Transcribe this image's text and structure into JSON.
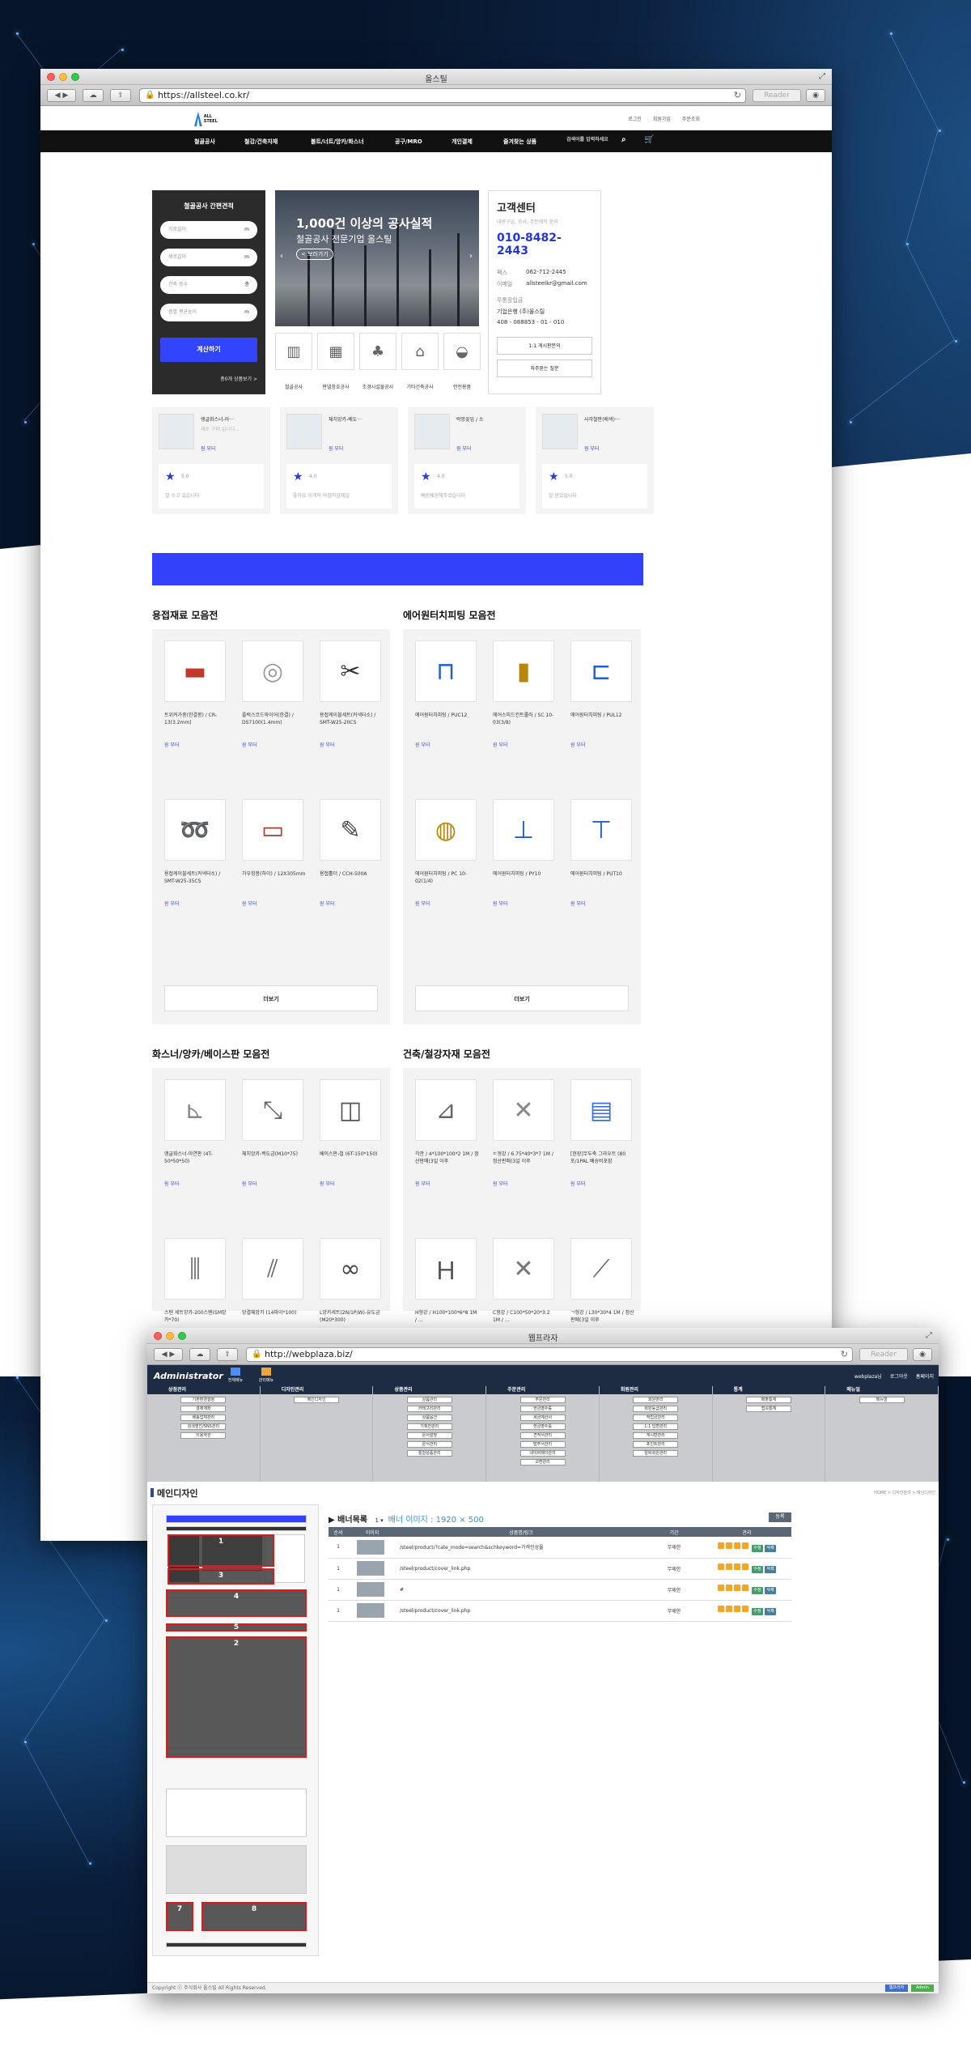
{
  "colors": {
    "accent": "#3441fb",
    "phone": "#2336d6",
    "dark": "#111111",
    "admin_nav": "#1d2b43",
    "highlight": "#e01818"
  },
  "window1": {
    "title": "올스틸",
    "url": "https://allsteel.co.kr/",
    "reader": "Reader",
    "logo": "ALL STEEL",
    "top_links": [
      "로그인",
      "회원가입",
      "주문조회"
    ],
    "nav": [
      "철골공사",
      "철강/건축자재",
      "볼트/너트/앙카/화스너",
      "공구/MRO",
      "개인결제",
      "즐겨찾는 상품"
    ],
    "search_placeholder": "검색어를 입력하세요",
    "calc": {
      "title": "철골공사 간편견적",
      "fields": [
        {
          "ph": "가로길이",
          "unit": "m"
        },
        {
          "ph": "세로길이",
          "unit": "m"
        },
        {
          "ph": "건축 층수",
          "unit": "층"
        },
        {
          "ph": "층별 평균높이",
          "unit": "m"
        }
      ],
      "button": "계산하기",
      "total": "총0개 상품보기 >"
    },
    "banner": {
      "line1": "1,000건 이상의 공사실적",
      "line2": "철골공사 전문기업 올스틸",
      "more": "< 보러가기"
    },
    "categories": [
      "철골공사",
      "판넬창호공사",
      "조경시설물공사",
      "기타건축공사",
      "안전용품"
    ],
    "cs": {
      "title": "고객센터",
      "sub": "대량구입, 공사, 주문제작 문의",
      "phone": "010-8482-2443",
      "fax_label": "팩스",
      "fax": "062-712-2445",
      "mail_label": "이메일",
      "mail": "allsteelkr@gmail.com",
      "bank_label": "무통장입금",
      "bank": "기업은행 (주)올스틸",
      "account": "408 - 088853 - 01 - 010",
      "btn1": "1:1 게시판문의",
      "btn2": "자주묻는 질문"
    },
    "reviews": [
      {
        "name": "앵글화스너-아···",
        "sub": "새로 구매 입니다...",
        "price": "원 부터",
        "score": "5.0",
        "text": "잘 쓰고 있습니다"
      },
      {
        "name": "체치앙카-배도···",
        "sub": "",
        "price": "원 부터",
        "score": "4.0",
        "text": "좋아요 이게딱 마감마감제일"
      },
      {
        "name": "락앙꽂입 / 소",
        "sub": "",
        "price": "원 부터",
        "score": "4.0",
        "text": "빠른배송해주셨습니다"
      },
      {
        "name": "사각철판(배색)···",
        "sub": "",
        "price": "원 부터",
        "score": "5.0",
        "text": "잘 받았습니다"
      }
    ],
    "sections": [
      {
        "title": "용접재료 모음전",
        "more": "더보기",
        "items": [
          {
            "name": "트위커가중(한결봉) / CR-13(3.2mm)",
            "price": "원 부터"
          },
          {
            "name": "플럭스코드와이어(한결) / DS7100(1.4mm)",
            "price": "원 부터"
          },
          {
            "name": "용접케이블세트(커넥터소) / SMT-W25-20CS",
            "price": "원 부터"
          },
          {
            "name": "용접케이블세트(커넥터소) / SMT-W25-35CS",
            "price": "원 부터"
          },
          {
            "name": "가우징봉(하이) / 12X305mm",
            "price": "원 부터"
          },
          {
            "name": "용접홀더 / CCH-500A",
            "price": "원 부터"
          }
        ]
      },
      {
        "title": "에어원터치피팅 모음전",
        "more": "더보기",
        "items": [
          {
            "name": "에어원터치피팅 / PUC12",
            "price": "원 부터"
          },
          {
            "name": "에어스피드컨트롤러 / SC 10-03(3/8)",
            "price": "원 부터"
          },
          {
            "name": "에어원터치피팅 / PUL12",
            "price": "원 부터"
          },
          {
            "name": "에어원터치피팅 / PC 10-02(1/4)",
            "price": "원 부터"
          },
          {
            "name": "에어원터치피팅 / PY10",
            "price": "원 부터"
          },
          {
            "name": "에어원터치피팅 / PUT10",
            "price": "원 부터"
          }
        ]
      },
      {
        "title": "화스너/앙카/베이스판 모음전",
        "more": "더보기",
        "items": [
          {
            "name": "앵글화스너-아연판 (4T-50*50*50)",
            "price": "원 부터"
          },
          {
            "name": "체치앙카-백도금(M10*75)",
            "price": "원 부터"
          },
          {
            "name": "베이스판-철 (6T-150*150)",
            "price": "원 부터"
          },
          {
            "name": "스텐 세트앙카-200스텐(SM앙카*70)",
            "price": "원 부터"
          },
          {
            "name": "앙결체앙카 (14파이*100)",
            "price": "원 부터"
          },
          {
            "name": "L앙카세트(2N/1P/W)-유도금 (M20*300)",
            "price": "원 부터"
          }
        ]
      },
      {
        "title": "건축/철강자재 모음전",
        "more": "더보기",
        "items": [
          {
            "name": "각관 / 4*100*100*2 1M / 정산판매(3일 이후",
            "price": "원 부터"
          },
          {
            "name": "ㄷ형강 / 6.75*40*3*7 1M / 정산판매(3일 이후",
            "price": "원 부터"
          },
          {
            "name": "[현장]무두축 그라우트 (80포/1PAL 배송비포함",
            "price": "원 부터"
          },
          {
            "name": "H형강 / H100*100*6*8 1M / ...",
            "price": "원 부터"
          },
          {
            "name": "C형강 / C100*50*20*3.2 1M / ...",
            "price": "원 부터"
          },
          {
            "name": "ㄱ형강 / L30*30*4 1M / 정산판매(3일 이후",
            "price": "원 부터"
          }
        ]
      }
    ]
  },
  "window2": {
    "title": "웹프라자",
    "url": "http://webplaza.biz/",
    "reader": "Reader",
    "app": "Administrator",
    "icons": [
      "전체메뉴",
      "관리메뉴"
    ],
    "user": "webplaza님",
    "header_links": [
      "로그아웃",
      "홈페이지"
    ],
    "menu": [
      {
        "head": "상점관리",
        "items": [
          "기본환경설정",
          "결제계좌",
          "배송업체관리",
          "검색엔진/SNS관리",
          "이용약관"
        ]
      },
      {
        "head": "디자인관리",
        "items": [
          "메인디자인"
        ]
      },
      {
        "head": "상품관리",
        "items": [
          "상품관리",
          "카테고리관리",
          "상품옵션",
          "기획전관리",
          "문서설정",
          "문서관리",
          "통합상품관리"
        ]
      },
      {
        "head": "주문관리",
        "items": [
          "주문관리",
          "현금영수증",
          "세금계산서",
          "현금영수증",
          "견적서관리",
          "발주서관리",
          "네이버페이관리",
          "교환관리"
        ]
      },
      {
        "head": "회원관리",
        "items": [
          "회원관리",
          "회원등급관리",
          "적립금관리",
          "1:1 답변관리",
          "게시판관리",
          "포인트관리",
          "탈퇴회원관리"
        ]
      },
      {
        "head": "통계",
        "items": [
          "매출통계",
          "접속통계"
        ]
      },
      {
        "head": "메뉴얼",
        "items": [
          "메뉴얼"
        ]
      }
    ],
    "page_title": "메인디자인",
    "breadcrumb": "HOME > 디자인관리 > 메인디자인",
    "list_title": "배너목록",
    "list_select": "1 ▾",
    "size_label": "배너 이미지 : 1920 × 500",
    "register": "등록",
    "columns": [
      "순서",
      "이미지",
      "상품명/링크",
      "기간",
      "관리"
    ],
    "rows": [
      {
        "no": "1",
        "link": "/steel/product/?cate_mode=search&schkeyword=가격인상율",
        "period": "무제한"
      },
      {
        "no": "1",
        "link": "/steel/product/cover_link.php",
        "period": "무제한"
      },
      {
        "no": "1",
        "link": "#",
        "period": "무제한"
      },
      {
        "no": "1",
        "link": "/steel/product/cover_link.php",
        "period": "무제한"
      }
    ],
    "action_labels": [
      "수정",
      "삭제"
    ],
    "marks": [
      "1",
      "2",
      "3",
      "4",
      "5",
      "7",
      "8"
    ],
    "footer": "Copyright ⓒ 주식회사 올스틸 All Rights Reserved.",
    "footer_btns": [
      "웹프라자",
      "Admin"
    ]
  }
}
